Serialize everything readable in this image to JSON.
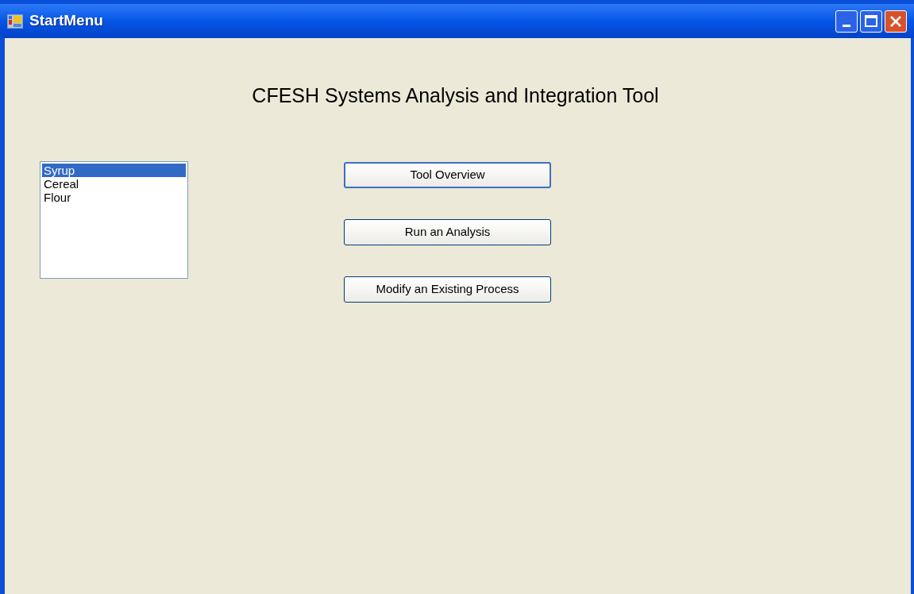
{
  "window": {
    "title": "StartMenu"
  },
  "heading": "CFESH Systems Analysis and Integration Tool",
  "list": [
    {
      "label": "Syrup",
      "selected": true
    },
    {
      "label": "Cereal",
      "selected": false
    },
    {
      "label": "Flour",
      "selected": false
    }
  ],
  "buttons": [
    {
      "label": "Tool Overview",
      "focused": true
    },
    {
      "label": "Run an Analysis",
      "focused": false
    },
    {
      "label": "Modify an Existing Process",
      "focused": false
    }
  ]
}
